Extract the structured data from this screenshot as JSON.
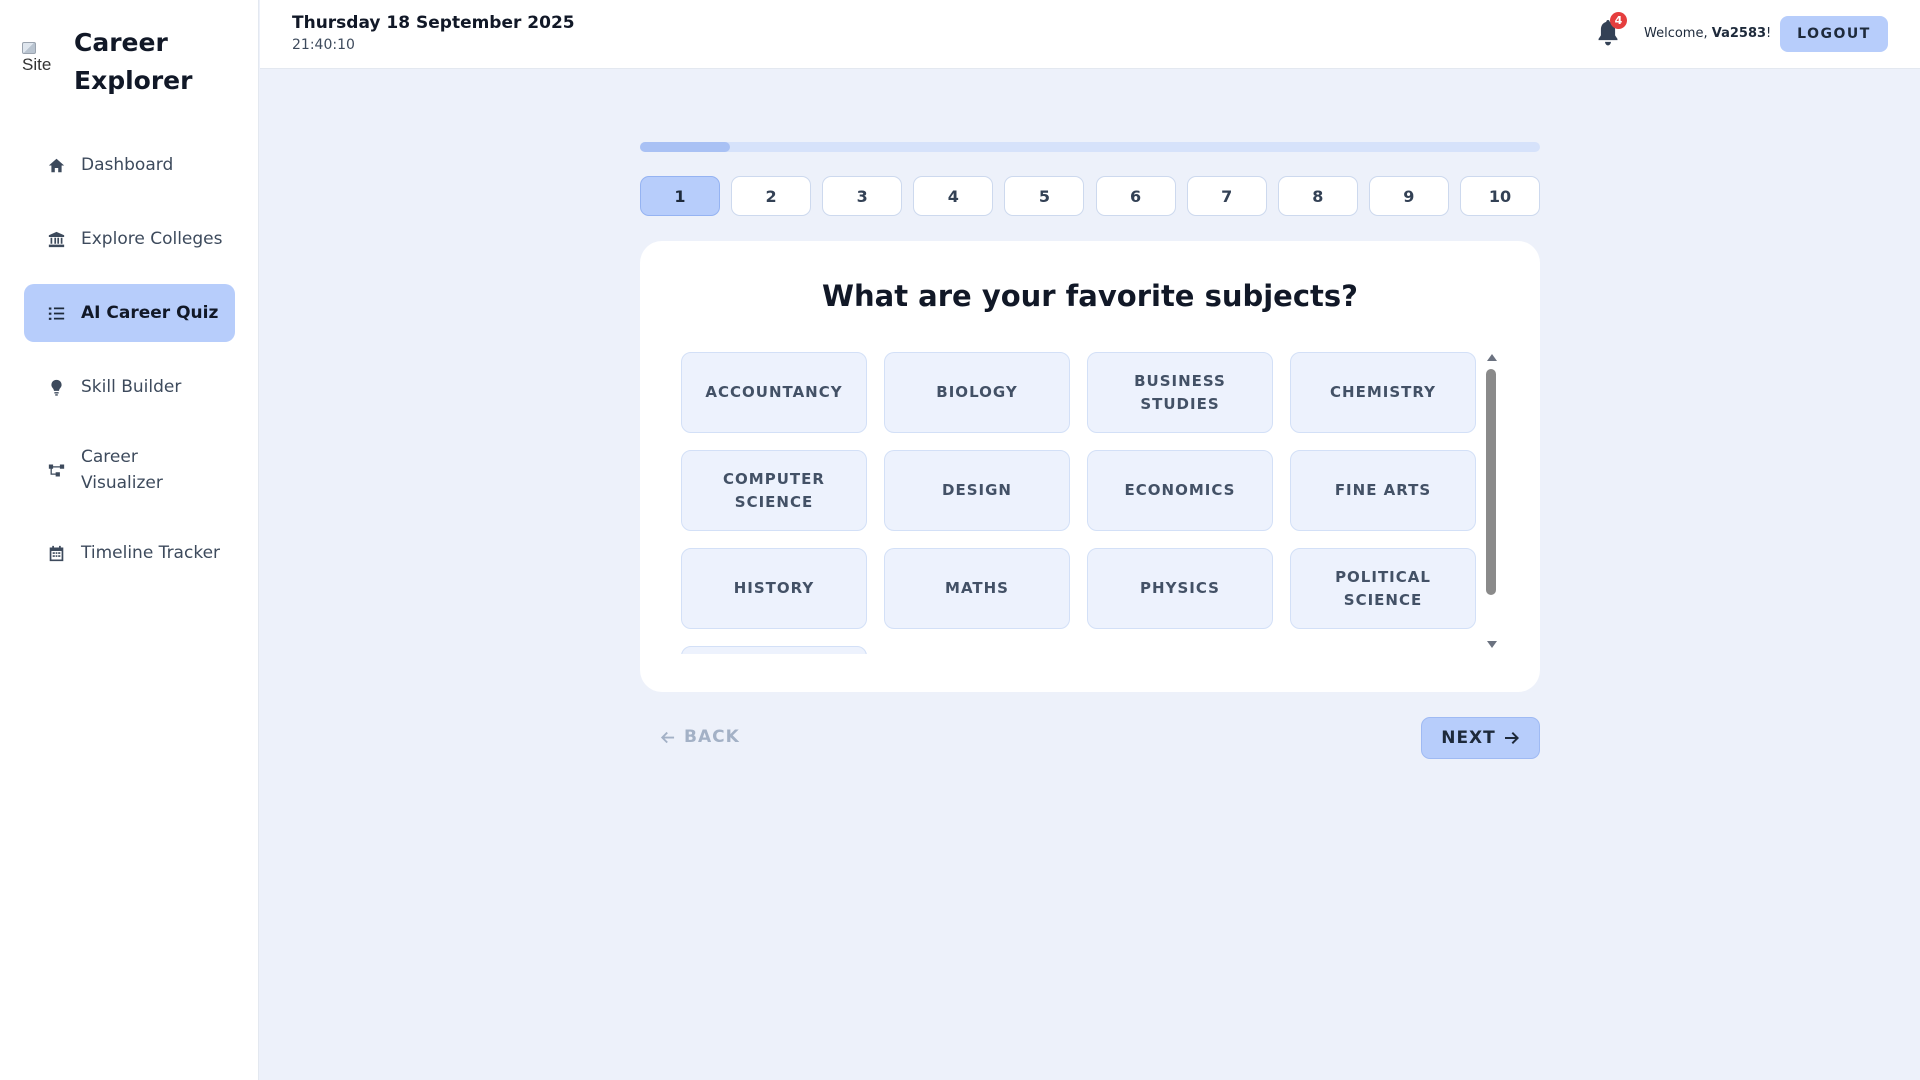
{
  "brand": {
    "logo_alt": "Site",
    "title": "Career Explorer"
  },
  "sidebar": {
    "items": [
      {
        "label": "Dashboard",
        "icon": "home-icon"
      },
      {
        "label": "Explore Colleges",
        "icon": "bank-icon"
      },
      {
        "label": "AI Career Quiz",
        "icon": "list-icon",
        "active": true
      },
      {
        "label": "Skill Builder",
        "icon": "lightbulb-icon"
      },
      {
        "label": "Career Visualizer",
        "icon": "sitemap-icon"
      },
      {
        "label": "Timeline Tracker",
        "icon": "calendar-icon"
      }
    ]
  },
  "header": {
    "date": "Thursday 18 September 2025",
    "time": "21:40:10",
    "notification_count": "4",
    "welcome_prefix": "Welcome, ",
    "username": "Va2583",
    "welcome_suffix": "!",
    "logout_label": "LOGOUT"
  },
  "quiz": {
    "progress_fraction": 0.1,
    "steps": [
      "1",
      "2",
      "3",
      "4",
      "5",
      "6",
      "7",
      "8",
      "9",
      "10"
    ],
    "current_step": "1",
    "question": "What are your favorite subjects?",
    "options": [
      "ACCOUNTANCY",
      "BIOLOGY",
      "BUSINESS STUDIES",
      "CHEMISTRY",
      "COMPUTER SCIENCE",
      "DESIGN",
      "ECONOMICS",
      "FINE ARTS",
      "HISTORY",
      "MATHS",
      "PHYSICS",
      "POLITICAL SCIENCE",
      ""
    ],
    "back_label": "BACK",
    "next_label": "NEXT"
  },
  "colors": {
    "accent": "#b7cdfb",
    "background": "#edf1fa",
    "badge": "#e53e3e"
  }
}
